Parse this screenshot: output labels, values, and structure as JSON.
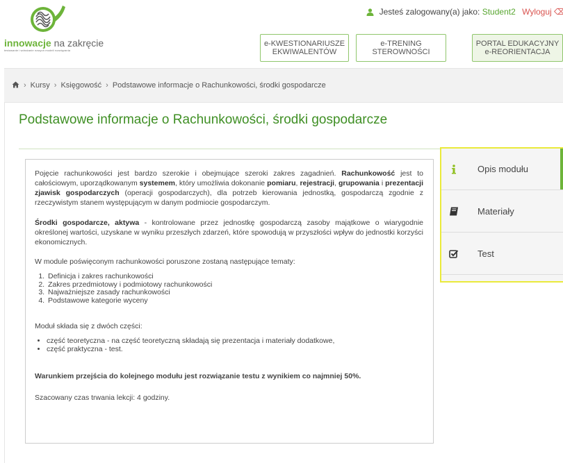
{
  "header": {
    "logo": {
      "brand_bold": "innowacje",
      "brand_rest": "na zakręcie",
      "tagline": "testowanie i wdrażanie nowych modeli rozwiązania"
    },
    "user_bar": {
      "prefix": "Jesteś zalogowany(a) jako:",
      "username": "Student2",
      "logout": "Wyloguj"
    },
    "nav": [
      {
        "line1": "e-KWESTIONARIUSZE",
        "line2": "EKWIWALENTÓW"
      },
      {
        "line1": "e-TRENING",
        "line2": "STEROWNOŚCI"
      },
      {
        "line1": "PORTAL EDUKACYJNY",
        "line2": "e-REORIENTACJA"
      }
    ]
  },
  "breadcrumb": {
    "items": [
      "Kursy",
      "Księgowość",
      "Podstawowe informacje o Rachunkowości, środki gospodarcze"
    ]
  },
  "page": {
    "title": "Podstawowe informacje o Rachunkowości, środki gospodarcze"
  },
  "content": {
    "p1": {
      "t1": "Pojęcie rachunkowości jest bardzo szerokie i obejmujące szeroki zakres zagadnień. ",
      "b1": "Rachunkowość",
      "t2": " jest to całościowym, uporządkowanym ",
      "b2": "systemem",
      "t3": ", który umożliwia dokonanie ",
      "b3": "pomiaru",
      "t4": ", ",
      "b4": "rejestracji",
      "t5": ", ",
      "b5": "grupowania",
      "t6": " i ",
      "b6": "prezentacji zjawisk gospodarczych",
      "t7": " (operacji gospodarczych), dla potrzeb kierowania jednostką, gospodarczą zgodnie z rzeczywistym stanem występującym w danym podmiocie gospodarczym."
    },
    "p2": {
      "b1": "Środki gospodarcze, aktywa",
      "t1": " - kontrolowane przez jednostkę gospodarczą zasoby majątkowe o wiarygodnie określonej wartości, uzyskane w wyniku przeszłych zdarzeń, które spowodują w przyszłości wpływ do jednostki korzyści ekonomicznych."
    },
    "p3": "W module poświęconym rachunkowości poruszone zostaną następujące tematy:",
    "topics": [
      "Definicja i zakres rachunkowości",
      "Zakres przedmiotowy i podmiotowy rachunkowości",
      "Najważniejsze zasady rachunkowości",
      "Podstawowe kategorie wyceny"
    ],
    "p4": "Moduł składa się z dwóch części:",
    "parts": [
      "część teoretyczna - na część teoretyczną składają się prezentacja i materiały dodatkowe,",
      "część praktyczna - test."
    ],
    "p5": "Warunkiem przejścia do kolejnego modułu jest rozwiązanie testu z wynikiem co najmniej 50%.",
    "p6": "Szacowany czas trwania lekcji: 4 godziny."
  },
  "side_menu": [
    {
      "label": "Opis modułu",
      "icon": "info-icon",
      "active": true
    },
    {
      "label": "Materiały",
      "icon": "book-icon",
      "active": false
    },
    {
      "label": "Test",
      "icon": "checkbox-icon",
      "active": false
    }
  ],
  "colors": {
    "brand_green": "#6db43a",
    "title_green": "#3f8f24",
    "menu_highlight": "#eaea3a",
    "logout_red": "#d9534f"
  }
}
